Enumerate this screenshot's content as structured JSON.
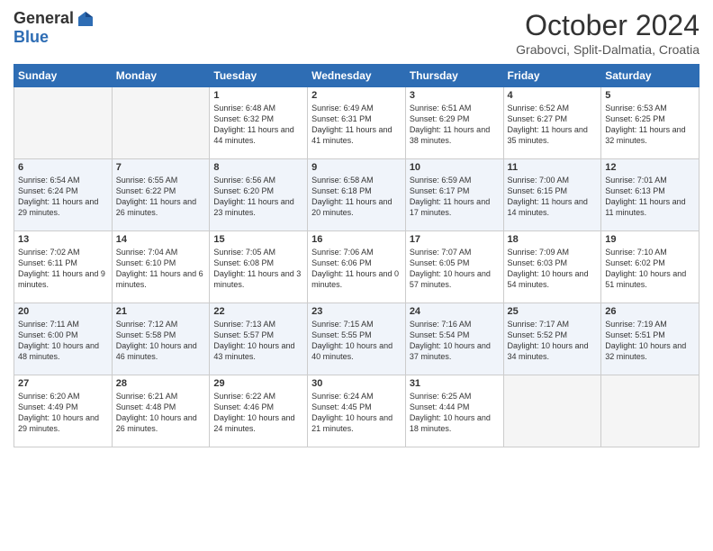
{
  "logo": {
    "general": "General",
    "blue": "Blue"
  },
  "header": {
    "month": "October 2024",
    "location": "Grabovci, Split-Dalmatia, Croatia"
  },
  "weekdays": [
    "Sunday",
    "Monday",
    "Tuesday",
    "Wednesday",
    "Thursday",
    "Friday",
    "Saturday"
  ],
  "weeks": [
    [
      {
        "day": "",
        "sunrise": "",
        "sunset": "",
        "daylight": ""
      },
      {
        "day": "",
        "sunrise": "",
        "sunset": "",
        "daylight": ""
      },
      {
        "day": "1",
        "sunrise": "Sunrise: 6:48 AM",
        "sunset": "Sunset: 6:32 PM",
        "daylight": "Daylight: 11 hours and 44 minutes."
      },
      {
        "day": "2",
        "sunrise": "Sunrise: 6:49 AM",
        "sunset": "Sunset: 6:31 PM",
        "daylight": "Daylight: 11 hours and 41 minutes."
      },
      {
        "day": "3",
        "sunrise": "Sunrise: 6:51 AM",
        "sunset": "Sunset: 6:29 PM",
        "daylight": "Daylight: 11 hours and 38 minutes."
      },
      {
        "day": "4",
        "sunrise": "Sunrise: 6:52 AM",
        "sunset": "Sunset: 6:27 PM",
        "daylight": "Daylight: 11 hours and 35 minutes."
      },
      {
        "day": "5",
        "sunrise": "Sunrise: 6:53 AM",
        "sunset": "Sunset: 6:25 PM",
        "daylight": "Daylight: 11 hours and 32 minutes."
      }
    ],
    [
      {
        "day": "6",
        "sunrise": "Sunrise: 6:54 AM",
        "sunset": "Sunset: 6:24 PM",
        "daylight": "Daylight: 11 hours and 29 minutes."
      },
      {
        "day": "7",
        "sunrise": "Sunrise: 6:55 AM",
        "sunset": "Sunset: 6:22 PM",
        "daylight": "Daylight: 11 hours and 26 minutes."
      },
      {
        "day": "8",
        "sunrise": "Sunrise: 6:56 AM",
        "sunset": "Sunset: 6:20 PM",
        "daylight": "Daylight: 11 hours and 23 minutes."
      },
      {
        "day": "9",
        "sunrise": "Sunrise: 6:58 AM",
        "sunset": "Sunset: 6:18 PM",
        "daylight": "Daylight: 11 hours and 20 minutes."
      },
      {
        "day": "10",
        "sunrise": "Sunrise: 6:59 AM",
        "sunset": "Sunset: 6:17 PM",
        "daylight": "Daylight: 11 hours and 17 minutes."
      },
      {
        "day": "11",
        "sunrise": "Sunrise: 7:00 AM",
        "sunset": "Sunset: 6:15 PM",
        "daylight": "Daylight: 11 hours and 14 minutes."
      },
      {
        "day": "12",
        "sunrise": "Sunrise: 7:01 AM",
        "sunset": "Sunset: 6:13 PM",
        "daylight": "Daylight: 11 hours and 11 minutes."
      }
    ],
    [
      {
        "day": "13",
        "sunrise": "Sunrise: 7:02 AM",
        "sunset": "Sunset: 6:11 PM",
        "daylight": "Daylight: 11 hours and 9 minutes."
      },
      {
        "day": "14",
        "sunrise": "Sunrise: 7:04 AM",
        "sunset": "Sunset: 6:10 PM",
        "daylight": "Daylight: 11 hours and 6 minutes."
      },
      {
        "day": "15",
        "sunrise": "Sunrise: 7:05 AM",
        "sunset": "Sunset: 6:08 PM",
        "daylight": "Daylight: 11 hours and 3 minutes."
      },
      {
        "day": "16",
        "sunrise": "Sunrise: 7:06 AM",
        "sunset": "Sunset: 6:06 PM",
        "daylight": "Daylight: 11 hours and 0 minutes."
      },
      {
        "day": "17",
        "sunrise": "Sunrise: 7:07 AM",
        "sunset": "Sunset: 6:05 PM",
        "daylight": "Daylight: 10 hours and 57 minutes."
      },
      {
        "day": "18",
        "sunrise": "Sunrise: 7:09 AM",
        "sunset": "Sunset: 6:03 PM",
        "daylight": "Daylight: 10 hours and 54 minutes."
      },
      {
        "day": "19",
        "sunrise": "Sunrise: 7:10 AM",
        "sunset": "Sunset: 6:02 PM",
        "daylight": "Daylight: 10 hours and 51 minutes."
      }
    ],
    [
      {
        "day": "20",
        "sunrise": "Sunrise: 7:11 AM",
        "sunset": "Sunset: 6:00 PM",
        "daylight": "Daylight: 10 hours and 48 minutes."
      },
      {
        "day": "21",
        "sunrise": "Sunrise: 7:12 AM",
        "sunset": "Sunset: 5:58 PM",
        "daylight": "Daylight: 10 hours and 46 minutes."
      },
      {
        "day": "22",
        "sunrise": "Sunrise: 7:13 AM",
        "sunset": "Sunset: 5:57 PM",
        "daylight": "Daylight: 10 hours and 43 minutes."
      },
      {
        "day": "23",
        "sunrise": "Sunrise: 7:15 AM",
        "sunset": "Sunset: 5:55 PM",
        "daylight": "Daylight: 10 hours and 40 minutes."
      },
      {
        "day": "24",
        "sunrise": "Sunrise: 7:16 AM",
        "sunset": "Sunset: 5:54 PM",
        "daylight": "Daylight: 10 hours and 37 minutes."
      },
      {
        "day": "25",
        "sunrise": "Sunrise: 7:17 AM",
        "sunset": "Sunset: 5:52 PM",
        "daylight": "Daylight: 10 hours and 34 minutes."
      },
      {
        "day": "26",
        "sunrise": "Sunrise: 7:19 AM",
        "sunset": "Sunset: 5:51 PM",
        "daylight": "Daylight: 10 hours and 32 minutes."
      }
    ],
    [
      {
        "day": "27",
        "sunrise": "Sunrise: 6:20 AM",
        "sunset": "Sunset: 4:49 PM",
        "daylight": "Daylight: 10 hours and 29 minutes."
      },
      {
        "day": "28",
        "sunrise": "Sunrise: 6:21 AM",
        "sunset": "Sunset: 4:48 PM",
        "daylight": "Daylight: 10 hours and 26 minutes."
      },
      {
        "day": "29",
        "sunrise": "Sunrise: 6:22 AM",
        "sunset": "Sunset: 4:46 PM",
        "daylight": "Daylight: 10 hours and 24 minutes."
      },
      {
        "day": "30",
        "sunrise": "Sunrise: 6:24 AM",
        "sunset": "Sunset: 4:45 PM",
        "daylight": "Daylight: 10 hours and 21 minutes."
      },
      {
        "day": "31",
        "sunrise": "Sunrise: 6:25 AM",
        "sunset": "Sunset: 4:44 PM",
        "daylight": "Daylight: 10 hours and 18 minutes."
      },
      {
        "day": "",
        "sunrise": "",
        "sunset": "",
        "daylight": ""
      },
      {
        "day": "",
        "sunrise": "",
        "sunset": "",
        "daylight": ""
      }
    ]
  ]
}
